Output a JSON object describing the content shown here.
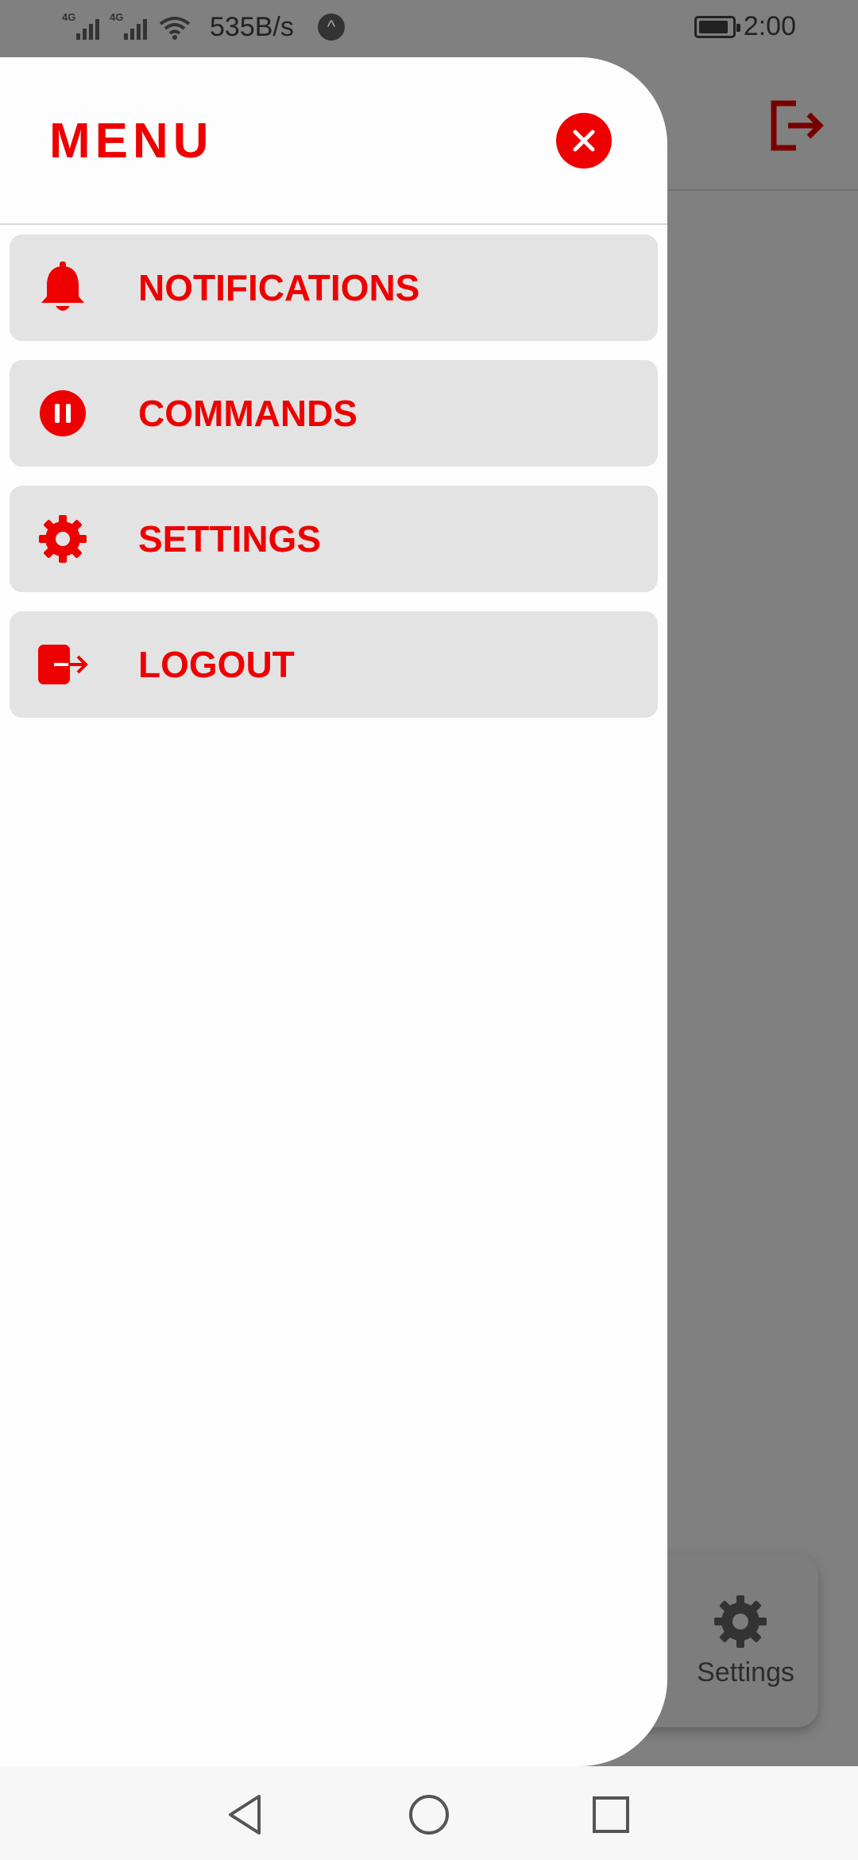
{
  "status_bar": {
    "network_tag_1": "4G",
    "network_tag_2": "4G",
    "net_speed": "535B/s",
    "vpn_icon": "caret-up-badge-icon",
    "time": "2:00",
    "battery_level": 0.9
  },
  "background": {
    "header_icon": "logout-icon",
    "settings_card_label": "Settings"
  },
  "drawer": {
    "title": "MENU",
    "close_icon": "close-icon",
    "items": [
      {
        "label": "NOTIFICATIONS",
        "icon": "bell-icon"
      },
      {
        "label": "COMMANDS",
        "icon": "pause-circle-icon"
      },
      {
        "label": "SETTINGS",
        "icon": "gear-icon"
      },
      {
        "label": "LOGOUT",
        "icon": "logout-icon"
      }
    ]
  },
  "colors": {
    "accent": "#ee0000",
    "item_bg": "#e3e3e3",
    "scrim": "#808080"
  }
}
